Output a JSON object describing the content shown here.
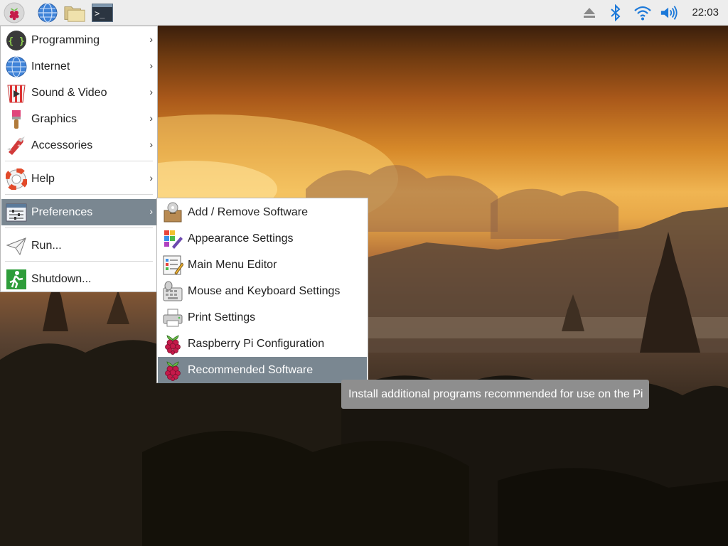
{
  "panel": {
    "launchers": [
      {
        "name": "raspberry-menu-icon"
      },
      {
        "name": "web-browser-icon"
      },
      {
        "name": "file-manager-icon"
      },
      {
        "name": "terminal-icon",
        "glyph": ">_"
      }
    ],
    "tray": [
      "eject-icon",
      "bluetooth-icon",
      "wifi-icon",
      "volume-icon"
    ],
    "clock": "22:03"
  },
  "main_menu": {
    "items": [
      {
        "label": "Programming",
        "icon": "programming-icon",
        "submenu": true
      },
      {
        "label": "Internet",
        "icon": "internet-globe-icon",
        "submenu": true
      },
      {
        "label": "Sound & Video",
        "icon": "sound-video-icon",
        "submenu": true
      },
      {
        "label": "Graphics",
        "icon": "graphics-brush-icon",
        "submenu": true
      },
      {
        "label": "Accessories",
        "icon": "pocketknife-icon",
        "submenu": true
      },
      {
        "label": "Help",
        "icon": "lifebuoy-icon",
        "submenu": true
      },
      {
        "label": "Preferences",
        "icon": "preferences-icon",
        "submenu": true,
        "highlighted": true
      },
      {
        "label": "Run...",
        "icon": "paper-plane-icon",
        "submenu": false
      },
      {
        "label": "Shutdown...",
        "icon": "exit-sign-icon",
        "submenu": false
      }
    ],
    "arrow": "›"
  },
  "preferences_menu": {
    "items": [
      {
        "label": "Add / Remove Software",
        "icon": "package-icon"
      },
      {
        "label": "Appearance Settings",
        "icon": "palette-icon"
      },
      {
        "label": "Main Menu Editor",
        "icon": "menu-editor-icon"
      },
      {
        "label": "Mouse and Keyboard Settings",
        "icon": "mouse-keyboard-icon"
      },
      {
        "label": "Print Settings",
        "icon": "printer-icon"
      },
      {
        "label": "Raspberry Pi Configuration",
        "icon": "raspberry-icon"
      },
      {
        "label": "Recommended Software",
        "icon": "raspberry-icon",
        "highlighted": true
      }
    ]
  },
  "tooltip": {
    "text": "Install additional programs recommended for use on the Pi"
  },
  "colors": {
    "highlight": "#7a8791",
    "tooltip_bg": "#8e8e8e",
    "raspberry_red": "#c51a4a",
    "leaf_green": "#6cc04a",
    "accent_blue": "#1c79d9"
  }
}
